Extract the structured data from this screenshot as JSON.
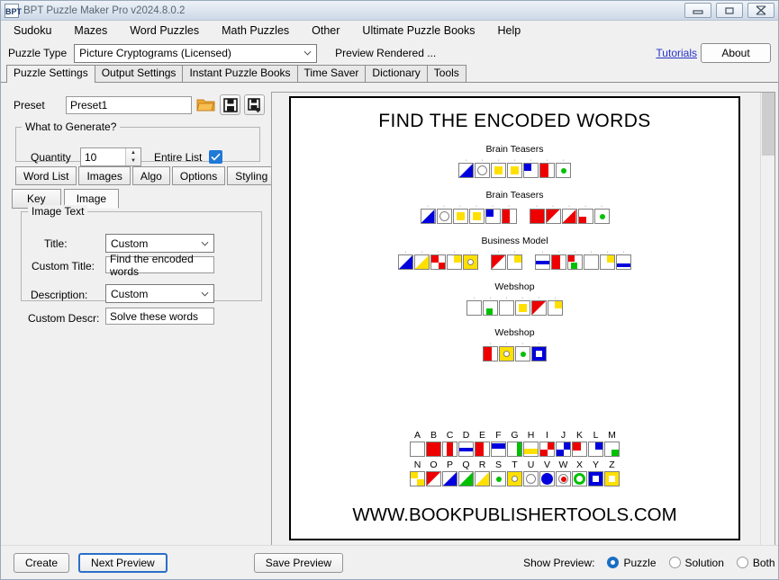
{
  "window": {
    "title": "BPT Puzzle Maker Pro v2024.8.0.2",
    "app_icon": "bpt",
    "minimize": "minimize-icon",
    "maximize": "maximize-icon",
    "close": "close-icon"
  },
  "menu": [
    {
      "label": "Sudoku"
    },
    {
      "label": "Mazes"
    },
    {
      "label": "Word Puzzles"
    },
    {
      "label": "Math Puzzles"
    },
    {
      "label": "Other"
    },
    {
      "label": "Ultimate Puzzle Books"
    },
    {
      "label": "Help"
    }
  ],
  "typerow": {
    "puzzle_type_label": "Puzzle Type",
    "puzzle_type_value": "Picture Cryptograms (Licensed)",
    "puzzle_type_options": [
      "Picture Cryptograms (Licensed)"
    ],
    "preview_rendered": "Preview Rendered ...",
    "tutorials_link": "Tutorials",
    "about_button": "About"
  },
  "tabs": [
    {
      "label": "Puzzle Settings",
      "active": true
    },
    {
      "label": "Output Settings",
      "active": false
    },
    {
      "label": "Instant Puzzle Books",
      "active": false
    },
    {
      "label": "Time Saver",
      "active": false
    },
    {
      "label": "Dictionary",
      "active": false
    },
    {
      "label": "Tools",
      "active": false
    }
  ],
  "settings": {
    "preset_label": "Preset",
    "preset_value": "Preset1",
    "open_icon": "folder-open-icon",
    "save_icon": "save-icon",
    "save_as_icon": "save-as-icon",
    "generate_group_label": "What to Generate?",
    "quantity_label": "Quantity",
    "quantity_value": "10",
    "entire_list_label": "Entire List",
    "entire_list_checked": true,
    "section_tabs": [
      {
        "label": "Word List",
        "active": false
      },
      {
        "label": "Images",
        "active": false
      },
      {
        "label": "Algo",
        "active": false
      },
      {
        "label": "Options",
        "active": false
      },
      {
        "label": "Styling",
        "active": false
      }
    ],
    "sub_tabs": [
      {
        "label": "Key",
        "active": false
      },
      {
        "label": "Image",
        "active": true
      }
    ],
    "image_text_group_label": "Image Text",
    "fields": {
      "title_label": "Title:",
      "title_value": "Custom",
      "title_options": [
        "Custom"
      ],
      "custom_title_label": "Custom Title:",
      "custom_title_value": "Find the encoded words",
      "description_label": "Description:",
      "description_value": "Custom",
      "description_options": [
        "Custom"
      ],
      "custom_descr_label": "Custom Descr:",
      "custom_descr_value": "Solve these words"
    }
  },
  "preview": {
    "title": "FIND THE ENCODED WORDS",
    "footer": "WWW.BOOKPUBLISHERTOOLS.COM",
    "words": [
      {
        "label": "Brain Teasers",
        "groups": [
          [
            "blue-tri-bl",
            "circle-white",
            "yellow-sq-sm",
            "yellow-sq-sm",
            "blue-sq-tl",
            "red-half-left",
            "green-dot"
          ]
        ]
      },
      {
        "label": "Brain Teasers",
        "groups": [
          [
            "blue-tri-bl",
            "circle-white",
            "yellow-sq-sm",
            "yellow-sq-sm",
            "blue-sq-tl",
            "red-half-left"
          ],
          [
            "red-full",
            "red-tri-tr",
            "red-tri-bl",
            "red-sq-bl",
            "green-dot"
          ]
        ]
      },
      {
        "label": "Business Model",
        "groups": [
          [
            "blue-tri-bl",
            "yellow-tri-br",
            "redwhite-quad",
            "yellow-sq-tl-notch",
            "yellow-circle-ring"
          ],
          [
            "red-tri-tr",
            "yellow-sq-tl-notch"
          ],
          [
            "blue-band-mid",
            "red-half-left",
            "green-sq-br-red-tl",
            "white-plain",
            "yellow-sq-tr",
            "blue-band-low"
          ]
        ]
      },
      {
        "label": "Webshop",
        "groups": [
          [
            "white-plain",
            "green-sq-bl",
            "white-plain",
            "yellow-sq-sm",
            "red-tri-tr",
            "yellow-sq-tr"
          ]
        ]
      },
      {
        "label": "Webshop",
        "groups": [
          [
            "red-half-left",
            "yellow-circle-ring",
            "green-dot",
            "blue-sq-inner"
          ]
        ]
      }
    ],
    "key": {
      "row1_letters": [
        "A",
        "B",
        "C",
        "D",
        "E",
        "F",
        "G",
        "H",
        "I",
        "J",
        "K",
        "L",
        "M"
      ],
      "row1_symbols": [
        "white-plain",
        "red-full",
        "red-stripe-mid",
        "blue-band-mid",
        "red-half-left",
        "blue-band-top",
        "green-stripe-right",
        "yellow-band-low",
        "red-quad-alt",
        "blue-quad-alt",
        "red-sq-tl",
        "blue-sq-tr",
        "green-sq-br"
      ],
      "row2_letters": [
        "N",
        "O",
        "P",
        "Q",
        "R",
        "S",
        "T",
        "U",
        "V",
        "W",
        "X",
        "Y",
        "Z"
      ],
      "row2_symbols": [
        "yellow-sq-tr-notch",
        "red-tri-tr",
        "blue-tri-bl",
        "green-tri-bl",
        "yellow-tri-br",
        "green-dot",
        "yellow-circle-ring",
        "circle-white",
        "blue-circle",
        "red-dot-ring",
        "green-ring",
        "blue-sq-inner",
        "yellow-sq-inner"
      ]
    }
  },
  "bottombar": {
    "create_button": "Create",
    "next_preview_button": "Next Preview",
    "save_preview_button": "Save Preview",
    "show_preview_label": "Show Preview:",
    "radio_options": [
      {
        "label": "Puzzle",
        "selected": true
      },
      {
        "label": "Solution",
        "selected": false
      },
      {
        "label": "Both",
        "selected": false
      }
    ]
  },
  "colors": {
    "red": "#ee0000",
    "blue": "#0000dd",
    "yellow": "#ffe000",
    "green": "#00c000",
    "accent": "#1a6fc4",
    "link": "#2632c8",
    "window_bg": "#f0f0f0",
    "border": "#808080"
  }
}
